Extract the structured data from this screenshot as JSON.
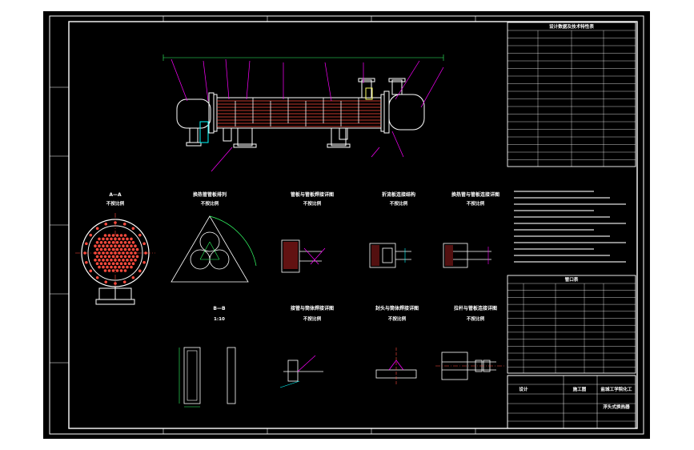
{
  "window": {
    "background": "#ffffff",
    "canvas_background": "#000000"
  },
  "colors": {
    "border": "#ffffff",
    "vessel": "#ffffff",
    "tubes": "#ff4a3d",
    "leaders": "#ff00ff",
    "nozzle": "#00ffff",
    "dims": "#33ff66",
    "text": "#ffffff",
    "small_text": "#ffff66"
  },
  "views": {
    "section_aa": {
      "title": "A—A",
      "scale": "不按比例"
    },
    "tube_layout": {
      "title": "换热管管板排列",
      "scale": "不按比例"
    },
    "tube_sheet_weld": {
      "title": "管板与管板焊接详图",
      "scale": "不按比例"
    },
    "baffle_detail": {
      "title": "折流板连接结构",
      "scale": "不按比例"
    },
    "tube_to_sheet": {
      "title": "换热管与管板连接详图",
      "scale": "不按比例"
    },
    "detail_bb": {
      "title": "B—B",
      "scale": "1:10"
    },
    "nozzle_weld": {
      "title": "接管与筒体焊接详图",
      "scale": "不按比例"
    },
    "head_weld": {
      "title": "封头与筒体焊接详图",
      "scale": "不按比例"
    },
    "tie_rod": {
      "title": "拉杆与管板连接详图",
      "scale": "不按比例"
    }
  },
  "spec_table": {
    "title": "设计数据及技术特性表"
  },
  "nozzle_table": {
    "title": "管口表"
  },
  "title_block": {
    "company": "盐城工学院化工",
    "drawing_title": "浮头式换热器",
    "designer": "设计",
    "stage": "施工图"
  }
}
